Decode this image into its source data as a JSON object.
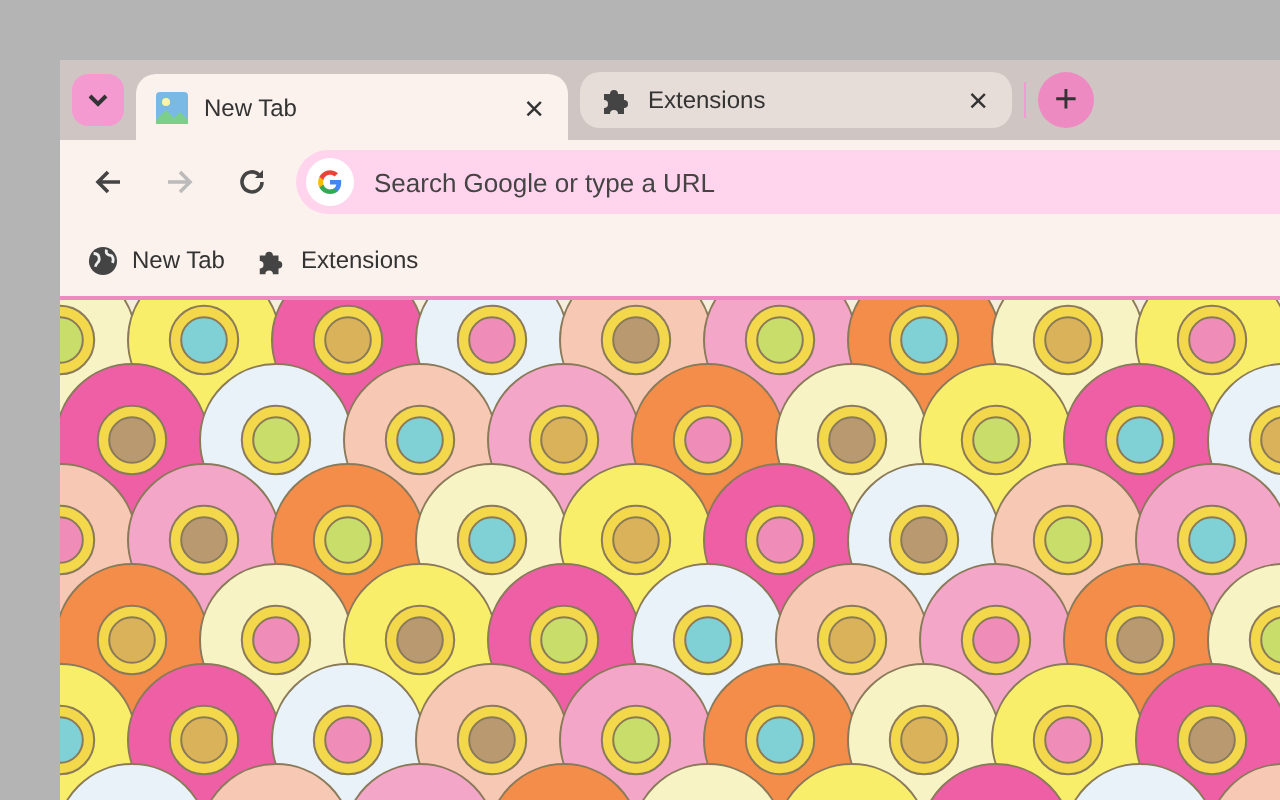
{
  "tabs": [
    {
      "title": "New Tab",
      "kind": "image",
      "selected": true,
      "close": "×"
    },
    {
      "title": "Extensions",
      "kind": "puzzle",
      "selected": false,
      "close": "×"
    }
  ],
  "new_tab_button": "+",
  "toolbar": {
    "back_disabled": false,
    "forward_disabled": true,
    "omnibox": {
      "placeholder": "Search Google or type a URL"
    }
  },
  "bookmarks": [
    {
      "title": "New Tab",
      "kind": "globe"
    },
    {
      "title": "Extensions",
      "kind": "puzzle"
    }
  ]
}
